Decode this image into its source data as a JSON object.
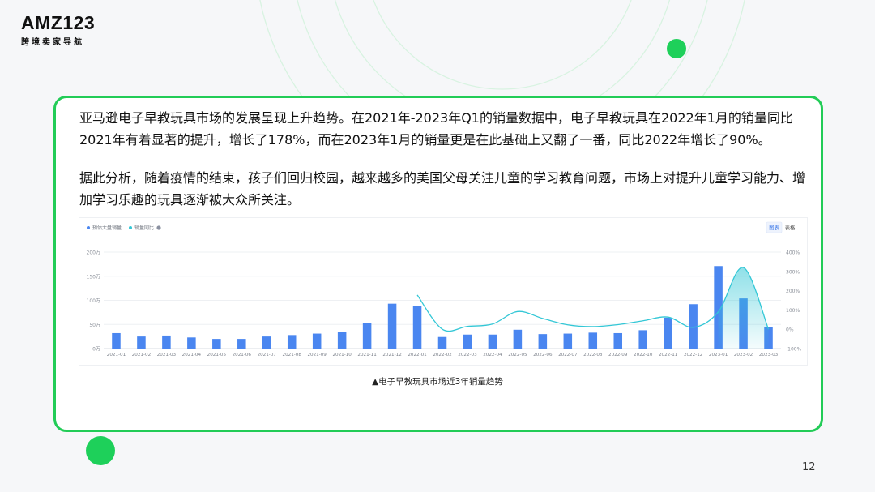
{
  "brand": {
    "mark": "AMZ123",
    "sub": "跨境卖家导航"
  },
  "paragraphs": [
    "亚马逊电子早教玩具市场的发展呈现上升趋势。在2021年-2023年Q1的销量数据中，电子早教玩具在2022年1月的销量同比2021年有着显著的提升，增长了178%，而在2023年1月的销量更是在此基础上又翻了一番，同比2022年增长了90%。",
    "据此分析，随着疫情的结束，孩子们回归校园，越来越多的美国父母关注儿童的学习教育问题，市场上对提升儿童学习能力、增加学习乐趣的玩具逐渐被大众所关注。"
  ],
  "caption": "▲电子早教玩具市场近3年销量趋势",
  "page_number": "12",
  "colors": {
    "accent_green": "#22cc57",
    "bar_blue": "#4a86f0",
    "line_teal": "#33c7d6"
  },
  "chart_data": {
    "type": "bar",
    "legend": {
      "position": "top-left",
      "items": [
        "预估大盘销量",
        "销量同比"
      ],
      "info_icon": "info-icon"
    },
    "view_toggle": [
      "图表",
      "表格"
    ],
    "categories": [
      "2021-01",
      "2021-02",
      "2021-03",
      "2021-04",
      "2021-05",
      "2021-06",
      "2021-07",
      "2021-08",
      "2021-09",
      "2021-10",
      "2021-11",
      "2021-12",
      "2022-01",
      "2022-02",
      "2022-03",
      "2022-04",
      "2022-05",
      "2022-06",
      "2022-07",
      "2022-08",
      "2022-09",
      "2022-10",
      "2022-11",
      "2022-12",
      "2023-01",
      "2023-02",
      "2023-03"
    ],
    "series": [
      {
        "name": "预估大盘销量",
        "type": "bar",
        "axis": "left",
        "values": [
          32,
          25,
          27,
          23,
          20,
          20,
          25,
          28,
          31,
          35,
          53,
          93,
          89,
          24,
          29,
          29,
          39,
          30,
          31,
          33,
          32,
          38,
          64,
          92,
          171,
          104,
          45
        ]
      },
      {
        "name": "销量同比",
        "type": "line",
        "axis": "right",
        "values": [
          null,
          null,
          null,
          null,
          null,
          null,
          null,
          null,
          null,
          null,
          null,
          null,
          178,
          0,
          15,
          27,
          92,
          56,
          23,
          14,
          24,
          44,
          63,
          10,
          90,
          320,
          0
        ]
      }
    ],
    "y_left": {
      "min": 0,
      "max": 200,
      "ticks": [
        "0万",
        "50万",
        "100万",
        "150万",
        "200万"
      ]
    },
    "y_right": {
      "min": -100,
      "max": 400,
      "ticks": [
        "-100%",
        "0%",
        "100%",
        "200%",
        "300%",
        "400%"
      ]
    },
    "grid": true
  }
}
